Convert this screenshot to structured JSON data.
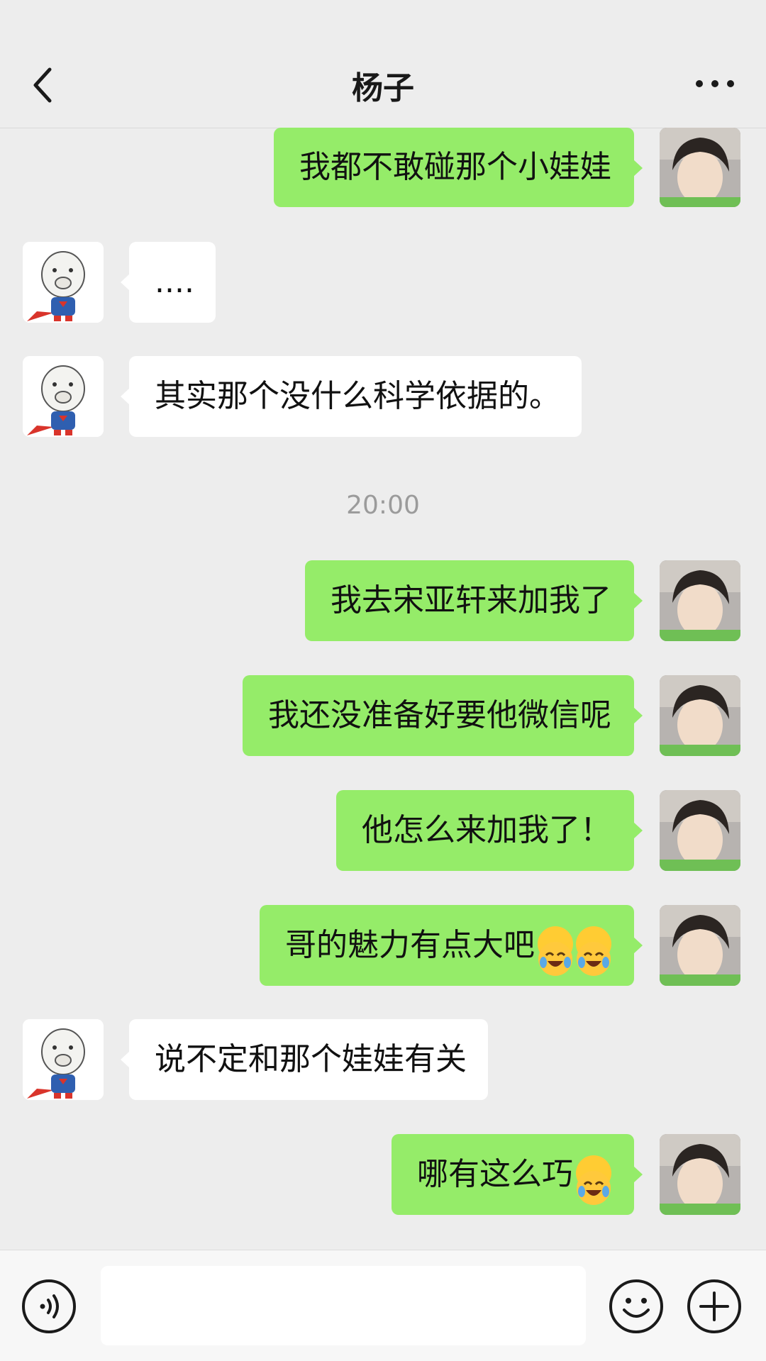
{
  "header": {
    "title": "杨子"
  },
  "messages": [
    {
      "side": "self",
      "text": "我都不敢碰那个小娃娃"
    },
    {
      "side": "peer",
      "text": "...."
    },
    {
      "side": "peer",
      "text": "其实那个没什么科学依据的。"
    },
    {
      "side": "self",
      "text": "我去宋亚轩来加我了"
    },
    {
      "side": "self",
      "text": "我还没准备好要他微信呢"
    },
    {
      "side": "self",
      "text": "他怎么来加我了！"
    },
    {
      "side": "self",
      "text": "哥的魅力有点大吧",
      "emoji_count": 2
    },
    {
      "side": "peer",
      "text": "说不定和那个娃娃有关"
    },
    {
      "side": "self",
      "text": "哪有这么巧",
      "emoji_count": 1
    }
  ],
  "timestamp": "20:00",
  "icons": {
    "back": "chevron-left-icon",
    "more": "more-dots-icon",
    "voice": "voice-icon",
    "emoji": "smile-icon",
    "plus": "plus-icon",
    "laughing_emoji": "laughing-crying-emoji"
  },
  "colors": {
    "self_bubble": "#95ec69",
    "peer_bubble": "#ffffff",
    "background": "#ededed"
  }
}
